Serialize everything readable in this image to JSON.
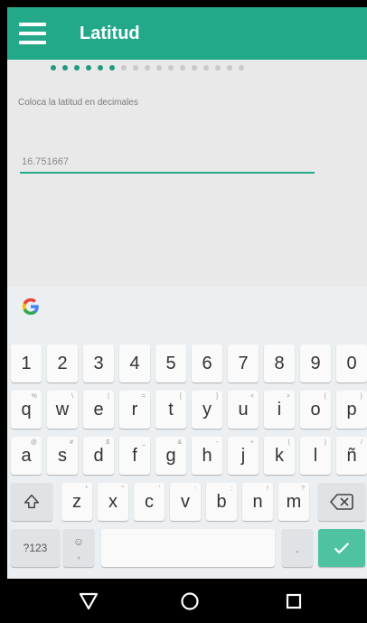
{
  "appbar": {
    "title": "Latitud",
    "menu_icon": "hamburger-menu-icon",
    "color": "#23a98a"
  },
  "progress": {
    "total_steps": 17,
    "current_step": 6
  },
  "form": {
    "instruction": "Coloca la latitud en decimales",
    "latitude_value": "16.751667"
  },
  "keyboard": {
    "google_icon": "google-g-icon",
    "rows": [
      [
        {
          "k": "1"
        },
        {
          "k": "2"
        },
        {
          "k": "3"
        },
        {
          "k": "4"
        },
        {
          "k": "5"
        },
        {
          "k": "6"
        },
        {
          "k": "7"
        },
        {
          "k": "8"
        },
        {
          "k": "9"
        },
        {
          "k": "0"
        }
      ],
      [
        {
          "k": "q",
          "h": "%"
        },
        {
          "k": "w",
          "h": "\\"
        },
        {
          "k": "e",
          "h": "|"
        },
        {
          "k": "r",
          "h": "="
        },
        {
          "k": "t",
          "h": "["
        },
        {
          "k": "y",
          "h": "]"
        },
        {
          "k": "u",
          "h": "<"
        },
        {
          "k": "i",
          "h": ">"
        },
        {
          "k": "o",
          "h": "{"
        },
        {
          "k": "p",
          "h": "}"
        }
      ],
      [
        {
          "k": "a",
          "h": "@"
        },
        {
          "k": "s",
          "h": "#"
        },
        {
          "k": "d",
          "h": "$"
        },
        {
          "k": "f",
          "h": "_"
        },
        {
          "k": "g",
          "h": "&"
        },
        {
          "k": "h",
          "h": "-"
        },
        {
          "k": "j",
          "h": "+"
        },
        {
          "k": "k",
          "h": "("
        },
        {
          "k": "l",
          "h": ")"
        },
        {
          "k": "ñ",
          "h": "/"
        }
      ],
      [
        {
          "k": "z",
          "h": "*"
        },
        {
          "k": "x",
          "h": "\""
        },
        {
          "k": "c",
          "h": "'"
        },
        {
          "k": "v",
          "h": ":"
        },
        {
          "k": "b",
          "h": ";"
        },
        {
          "k": "n",
          "h": "!"
        },
        {
          "k": "m",
          "h": "?"
        }
      ]
    ],
    "symbols_label": "?123",
    "emoji_hint": "☺",
    "comma_label": ",",
    "period_label": ".",
    "shift_icon": "shift-arrow-icon",
    "backspace_icon": "backspace-icon",
    "enter_icon": "checkmark-icon",
    "enter_color": "#4fc3a1"
  },
  "navbar": {
    "back_icon": "back-triangle-icon",
    "home_icon": "home-circle-icon",
    "recents_icon": "recents-square-icon"
  }
}
